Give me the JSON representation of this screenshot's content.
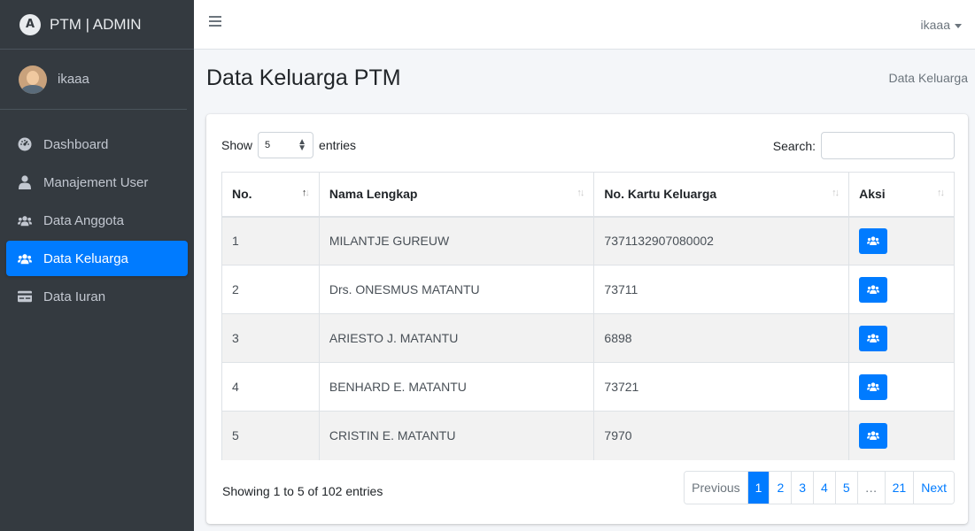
{
  "brand": {
    "logo_letter": "A",
    "title": "PTM | ADMIN"
  },
  "user": {
    "name": "ikaaa"
  },
  "sidebar": {
    "items": [
      {
        "label": "Dashboard",
        "icon": "tachometer-icon",
        "active": false
      },
      {
        "label": "Manajement User",
        "icon": "user-icon",
        "active": false
      },
      {
        "label": "Data Anggota",
        "icon": "users-icon",
        "active": false
      },
      {
        "label": "Data Keluarga",
        "icon": "users-icon",
        "active": true
      },
      {
        "label": "Data Iuran",
        "icon": "money-card-icon",
        "active": false
      }
    ]
  },
  "topbar": {
    "menu_icon": "hamburger-icon",
    "user_label": "ikaaa"
  },
  "header": {
    "title": "Data Keluarga PTM",
    "breadcrumb": "Data Keluarga"
  },
  "table_controls": {
    "show_label": "Show",
    "entries_value": "5",
    "entries_label": "entries",
    "search_label": "Search:",
    "search_value": ""
  },
  "table": {
    "columns": [
      "No.",
      "Nama Lengkap",
      "No. Kartu Keluarga",
      "Aksi"
    ],
    "rows": [
      {
        "no": "1",
        "nama": "MILANTJE GUREUW",
        "kk": "7371132907080002"
      },
      {
        "no": "2",
        "nama": "Drs. ONESMUS MATANTU",
        "kk": "73711"
      },
      {
        "no": "3",
        "nama": "ARIESTO J. MATANTU",
        "kk": "6898"
      },
      {
        "no": "4",
        "nama": "BENHARD E. MATANTU",
        "kk": "73721"
      },
      {
        "no": "5",
        "nama": "CRISTIN E. MATANTU",
        "kk": "7970"
      }
    ],
    "action_icon": "users-icon"
  },
  "footer": {
    "info": "Showing 1 to 5 of 102 entries",
    "pagination": [
      "Previous",
      "1",
      "2",
      "3",
      "4",
      "5",
      "…",
      "21",
      "Next"
    ],
    "active_page": "1"
  },
  "colors": {
    "sidebar": "#343a40",
    "accent": "#007bff",
    "background": "#f4f6f9"
  }
}
